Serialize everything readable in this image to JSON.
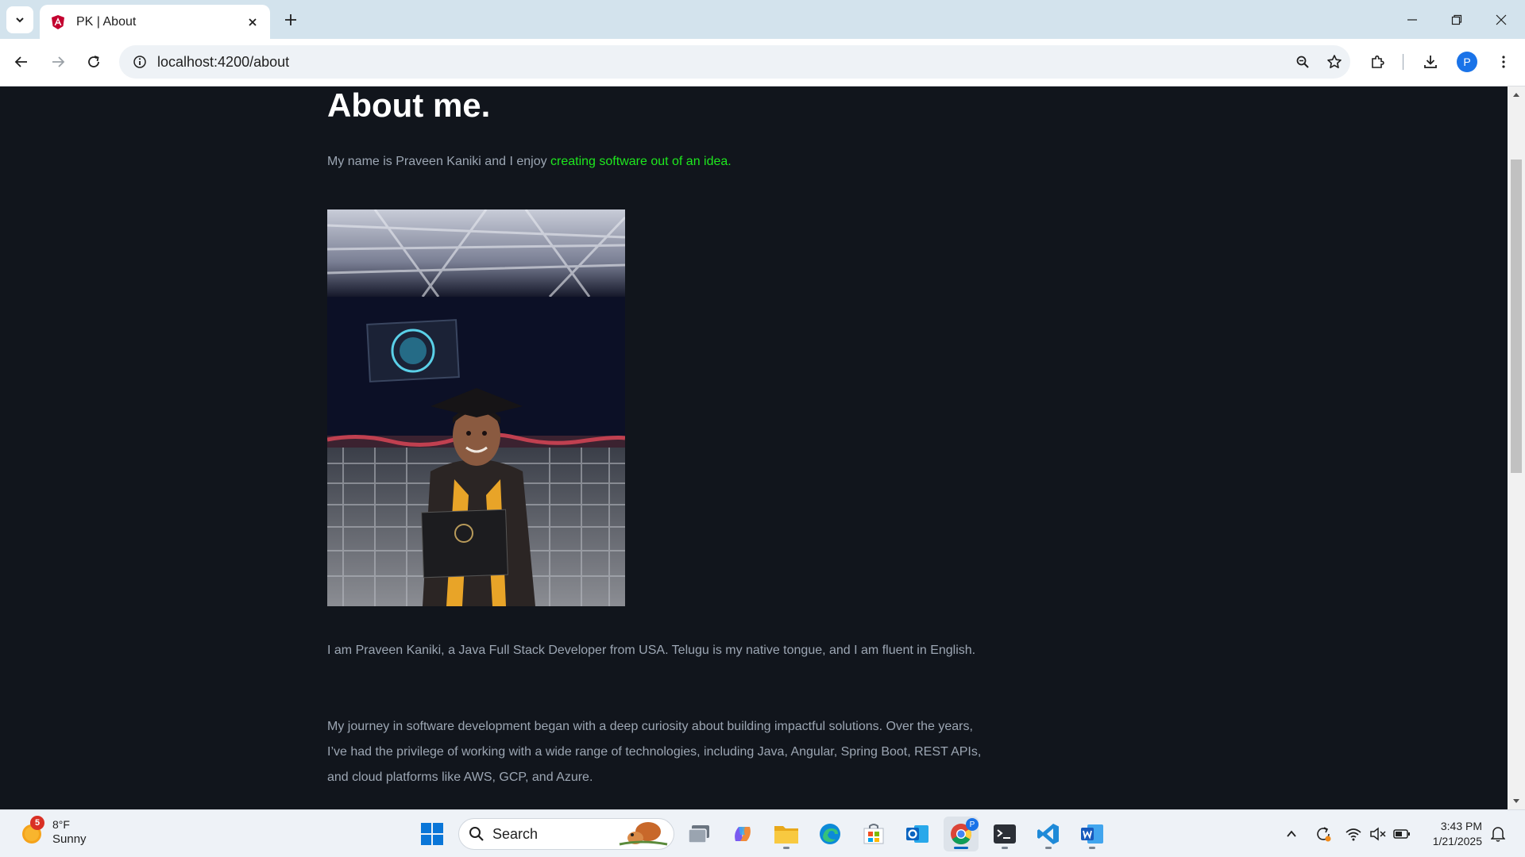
{
  "browser": {
    "tab_title": "PK | About",
    "url": "localhost:4200/about",
    "profile_initial": "P"
  },
  "page": {
    "heading": "About me.",
    "intro_prefix": "My name is Praveen Kaniki and I enjoy ",
    "intro_highlight": "creating software out of an idea",
    "intro_suffix": ".",
    "paragraph_1": "I am Praveen Kaniki, a Java Full Stack Developer from USA. Telugu is my native tongue, and I am fluent in English.",
    "paragraph_2": "My journey in software development began with a deep curiosity about building impactful solutions. Over the years, I’ve had the privilege of working with a wide range of technologies, including Java, Angular, Spring Boot, REST APIs, and cloud platforms like AWS, GCP, and Azure.",
    "highlight_color": "#1ee81e"
  },
  "taskbar": {
    "weather_badge": "5",
    "weather_temp": "8°F",
    "weather_condition": "Sunny",
    "search_label": "Search",
    "time": "3:43 PM",
    "date": "1/21/2025",
    "chrome_badge": "P"
  }
}
